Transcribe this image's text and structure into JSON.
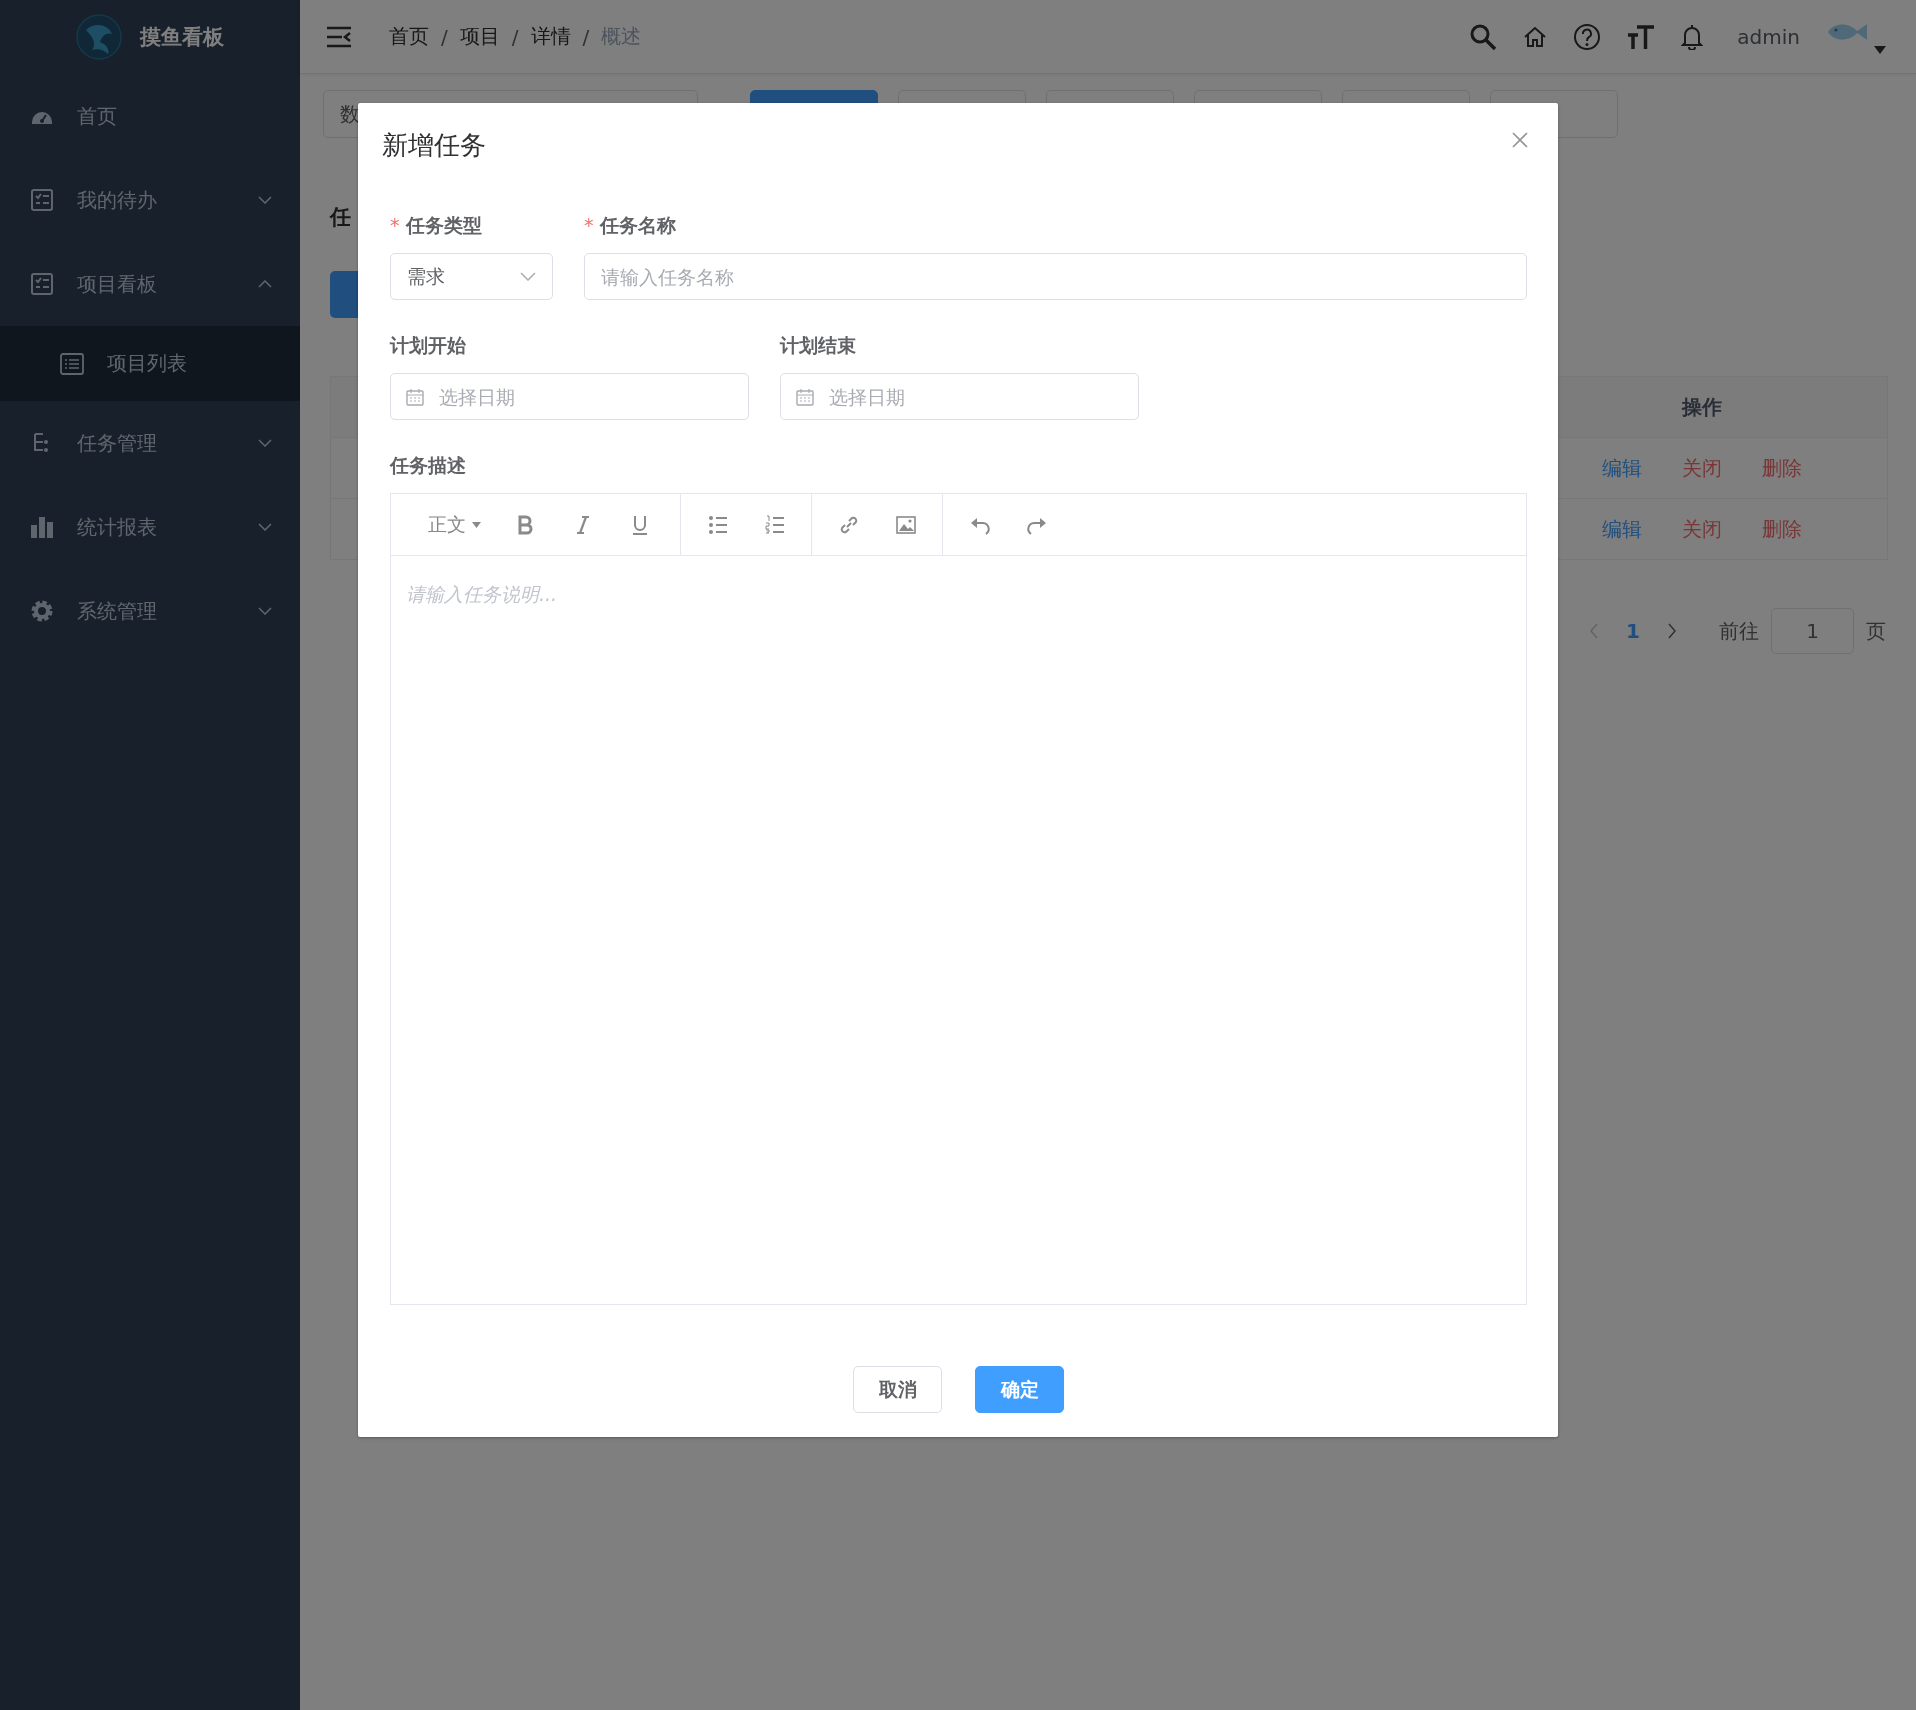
{
  "sidebar": {
    "logo_text": "摸鱼看板",
    "items": [
      {
        "label": "首页",
        "kind": "link"
      },
      {
        "label": "我的待办",
        "kind": "submenu",
        "expanded": false
      },
      {
        "label": "项目看板",
        "kind": "submenu",
        "expanded": true,
        "children": [
          {
            "label": "项目列表"
          }
        ]
      },
      {
        "label": "任务管理",
        "kind": "submenu",
        "expanded": false
      },
      {
        "label": "统计报表",
        "kind": "submenu",
        "expanded": false
      },
      {
        "label": "系统管理",
        "kind": "submenu",
        "expanded": false
      }
    ]
  },
  "header": {
    "breadcrumb": [
      {
        "label": "首页",
        "current": false
      },
      {
        "label": "项目",
        "current": false
      },
      {
        "label": "详情",
        "current": false
      },
      {
        "label": "概述",
        "current": true
      }
    ],
    "separator": "/",
    "user": "admin"
  },
  "content": {
    "filter_value": "数",
    "tab_buttons": [
      {
        "selected": true
      },
      {
        "selected": false
      },
      {
        "selected": false
      },
      {
        "selected": false
      },
      {
        "selected": false
      },
      {
        "selected": false
      }
    ],
    "section_title": "任",
    "table": {
      "columns": [
        "操作"
      ],
      "rows": [
        {
          "actions": [
            {
              "label": "编辑",
              "kind": "primary"
            },
            {
              "label": "关闭",
              "kind": "danger"
            },
            {
              "label": "删除",
              "kind": "danger"
            }
          ]
        },
        {
          "actions": [
            {
              "label": "编辑",
              "kind": "primary"
            },
            {
              "label": "关闭",
              "kind": "danger"
            },
            {
              "label": "删除",
              "kind": "danger"
            }
          ]
        }
      ]
    },
    "pagination": {
      "pages": [
        {
          "label": "1",
          "selected": true
        }
      ],
      "goto_label": "前往",
      "goto_value": "1",
      "page_suffix": "页"
    }
  },
  "dialog": {
    "title": "新增任务",
    "form": {
      "required_mark": "*",
      "rows": [
        {
          "fields": [
            {
              "kind": "select",
              "label": "任务类型",
              "required": true,
              "value": "需求"
            },
            {
              "kind": "text",
              "label": "任务名称",
              "required": true,
              "placeholder": "请输入任务名称"
            }
          ]
        },
        {
          "fields": [
            {
              "kind": "date",
              "label": "计划开始",
              "required": false,
              "placeholder": "选择日期"
            },
            {
              "kind": "date",
              "label": "计划结束",
              "required": false,
              "placeholder": "选择日期"
            }
          ]
        }
      ],
      "editor": {
        "label": "任务描述",
        "toolbar": [
          {
            "items": [
              {
                "kind": "heading",
                "label": "正文"
              },
              {
                "kind": "bold"
              },
              {
                "kind": "italic"
              },
              {
                "kind": "underline"
              }
            ]
          },
          {
            "items": [
              {
                "kind": "bullet-list"
              },
              {
                "kind": "numbered-list"
              }
            ]
          },
          {
            "items": [
              {
                "kind": "link"
              },
              {
                "kind": "image"
              }
            ]
          },
          {
            "items": [
              {
                "kind": "undo"
              },
              {
                "kind": "redo"
              }
            ]
          }
        ],
        "placeholder": "请输入任务说明..."
      }
    },
    "buttons": [
      {
        "label": "取消",
        "kind": "default"
      },
      {
        "label": "确定",
        "kind": "primary"
      }
    ]
  }
}
